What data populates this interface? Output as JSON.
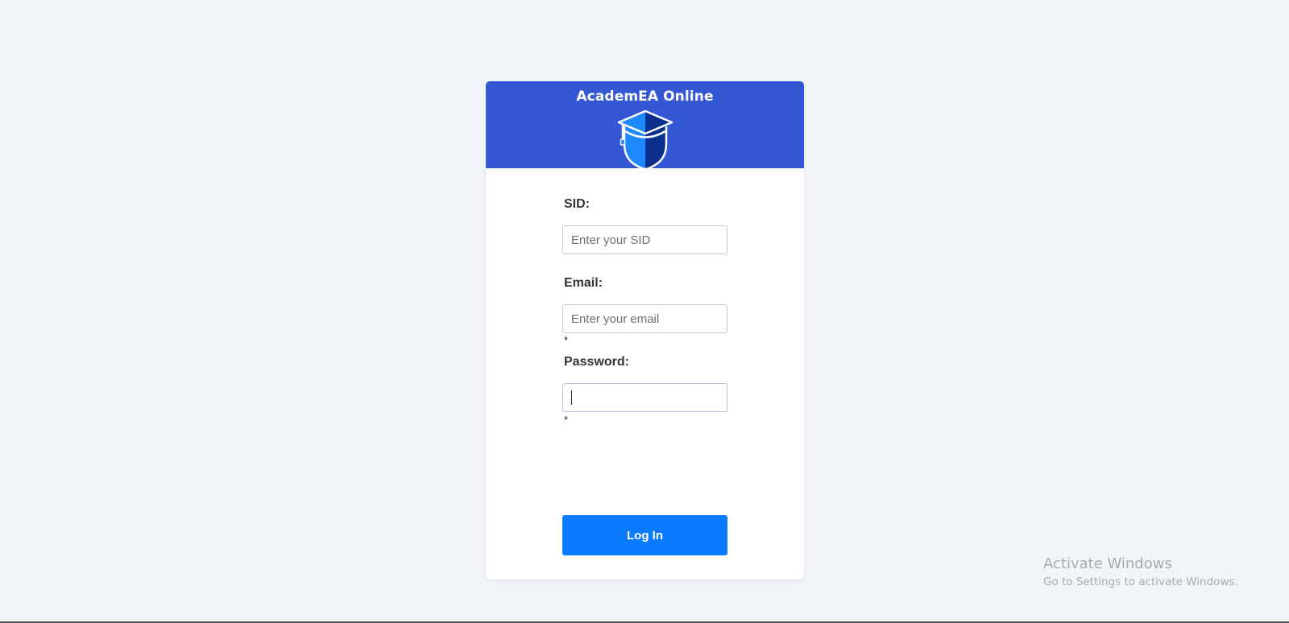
{
  "app": {
    "title": "AcademEA Online",
    "logo_icon": "graduation-cap-student-icon",
    "header_color": "#3458d4"
  },
  "form": {
    "sid": {
      "label": "SID:",
      "placeholder": "Enter your SID",
      "value": ""
    },
    "email": {
      "label": "Email:",
      "placeholder": "Enter your email",
      "value": "",
      "required_mark": "*"
    },
    "password": {
      "label": "Password:",
      "placeholder": "",
      "value": "",
      "required_mark": "*"
    },
    "submit_label": "Log In",
    "submit_color": "#0a7bff"
  },
  "watermark": {
    "title": "Activate Windows",
    "subtitle": "Go to Settings to activate Windows."
  }
}
